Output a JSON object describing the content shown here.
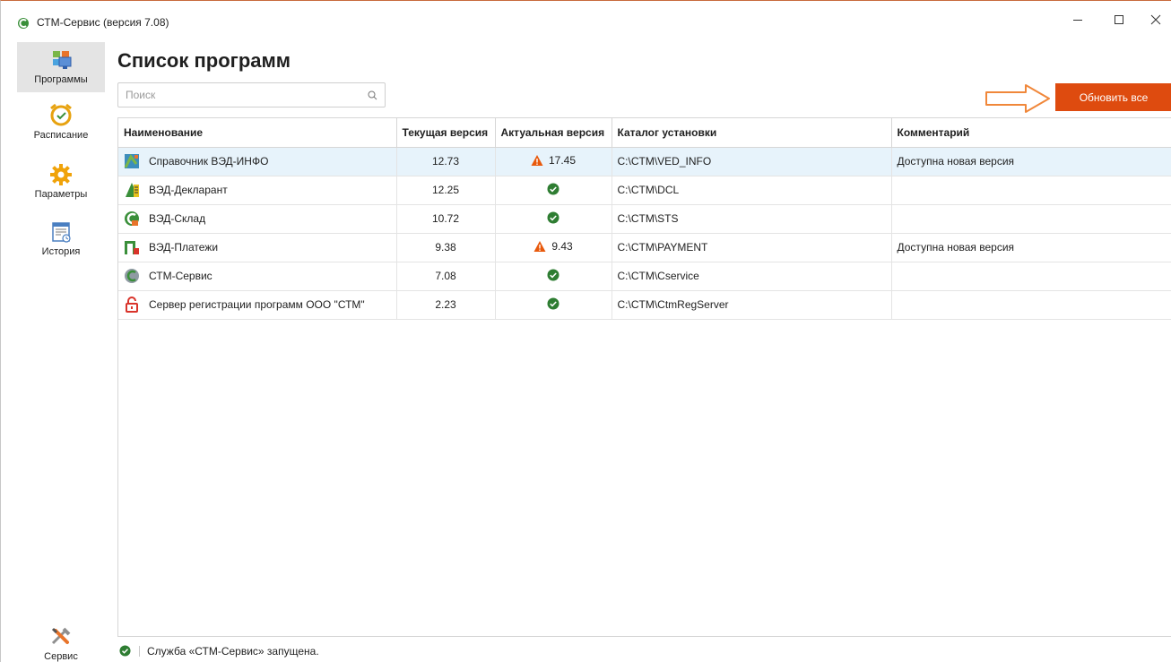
{
  "window": {
    "title": "СТМ-Сервис (версия 7.08)",
    "app_icon": "ctm-logo-icon",
    "controls": [
      "minimize-icon",
      "maximize-icon",
      "close-icon"
    ]
  },
  "sidebar": {
    "items": [
      {
        "label": "Программы",
        "icon": "programs-icon",
        "active": true
      },
      {
        "label": "Расписание",
        "icon": "alarm-clock-icon",
        "active": false
      },
      {
        "label": "Параметры",
        "icon": "gear-icon",
        "active": false
      },
      {
        "label": "История",
        "icon": "history-icon",
        "active": false
      }
    ],
    "service": {
      "label": "Сервис",
      "icon": "tools-icon"
    }
  },
  "main": {
    "title": "Список программ",
    "search": {
      "placeholder": "Поиск",
      "value": ""
    },
    "update_all_label": "Обновить все",
    "accent_color": "#de4b0f",
    "hint_arrow_color": "#f0873a"
  },
  "table": {
    "columns": [
      "Наименование",
      "Текущая версия",
      "Актуальная версия",
      "Каталог установки",
      "Комментарий"
    ],
    "rows": [
      {
        "name": "Справочник ВЭД-ИНФО",
        "icon": "ved-info-icon",
        "current": "12.73",
        "latest_status": "warning",
        "latest": "17.45",
        "path": "C:\\CTM\\VED_INFO",
        "comment": "Доступна новая версия",
        "selected": true
      },
      {
        "name": "ВЭД-Декларант",
        "icon": "ved-declarant-icon",
        "current": "12.25",
        "latest_status": "ok",
        "latest": "",
        "path": "C:\\CTM\\DCL",
        "comment": "",
        "selected": false
      },
      {
        "name": "ВЭД-Склад",
        "icon": "ved-sklad-icon",
        "current": "10.72",
        "latest_status": "ok",
        "latest": "",
        "path": "C:\\CTM\\STS",
        "comment": "",
        "selected": false
      },
      {
        "name": "ВЭД-Платежи",
        "icon": "ved-payments-icon",
        "current": "9.38",
        "latest_status": "warning",
        "latest": "9.43",
        "path": "C:\\CTM\\PAYMENT",
        "comment": "Доступна новая версия",
        "selected": false
      },
      {
        "name": "СТМ-Сервис",
        "icon": "ctm-service-icon",
        "current": "7.08",
        "latest_status": "ok",
        "latest": "",
        "path": "C:\\CTM\\Cservice",
        "comment": "",
        "selected": false
      },
      {
        "name": "Сервер регистрации программ ООО \"СТМ\"",
        "icon": "registration-server-icon",
        "current": "2.23",
        "latest_status": "ok",
        "latest": "",
        "path": "C:\\CTM\\CtmRegServer",
        "comment": "",
        "selected": false
      }
    ],
    "status_colors": {
      "ok": "#2e7d32",
      "warning": "#e8590c"
    }
  },
  "statusbar": {
    "text": "Служба «СТМ-Сервис» запущена.",
    "icon": "check-circle-icon"
  }
}
